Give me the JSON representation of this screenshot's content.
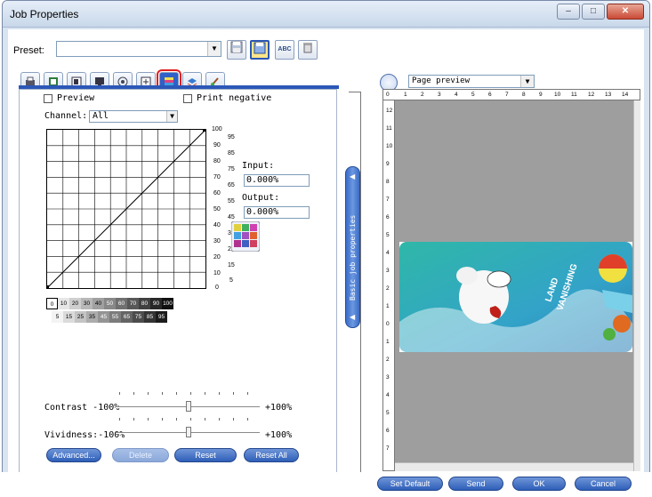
{
  "window": {
    "title": "Job Properties",
    "min_icon": "minimize-icon",
    "max_icon": "maximize-icon",
    "close_icon": "close-icon",
    "min_glyph": "–",
    "max_glyph": "□",
    "close_glyph": "✕"
  },
  "preset": {
    "label": "Preset:",
    "value": ""
  },
  "tabs": [
    "printer-tab",
    "media-tab",
    "layout-tab",
    "output-tab",
    "color-tab",
    "marks-tab",
    "curves-tab",
    "layers-tab",
    "paint-tab"
  ],
  "curves": {
    "preview_label": "Preview",
    "print_negative_label": "Print negative",
    "channel_label": "Channel:",
    "channel_value": "All",
    "input_label": "Input:",
    "input_value": "0.000%",
    "output_label": "Output:",
    "output_value": "0.000%",
    "scale_left": [
      "100",
      "90",
      "80",
      "70",
      "60",
      "50",
      "40",
      "30",
      "20",
      "10",
      "0"
    ],
    "scale_right": [
      "95",
      "85",
      "75",
      "65",
      "55",
      "45",
      "35",
      "25",
      "15",
      "5"
    ],
    "gradient_top": [
      "0",
      "10",
      "20",
      "30",
      "40",
      "50",
      "60",
      "70",
      "80",
      "90",
      "100"
    ],
    "gradient_bottom": [
      "5",
      "15",
      "25",
      "35",
      "45",
      "55",
      "65",
      "75",
      "85",
      "95"
    ],
    "contrast_label": "Contrast -100%",
    "contrast_max": "+100%",
    "contrast_value_percent": 0,
    "vividness_label": "Vividness:-100%",
    "vividness_max": "+100%",
    "vividness_value_percent": 0
  },
  "buttons": {
    "advanced": "Advanced...",
    "delete": "Delete",
    "reset": "Reset",
    "reset_all": "Reset All",
    "set_default": "Set Default",
    "send": "Send",
    "ok": "OK",
    "cancel": "Cancel"
  },
  "side_bar": {
    "label": "Basic job properties"
  },
  "preview": {
    "mode": "Page preview",
    "ruler_top": [
      "0",
      "1",
      "2",
      "3",
      "4",
      "5",
      "6",
      "7",
      "8",
      "9",
      "10",
      "11",
      "12",
      "13",
      "14"
    ],
    "ruler_left": [
      "12",
      "11",
      "10",
      "9",
      "8",
      "7",
      "6",
      "5",
      "4",
      "3",
      "2",
      "1",
      "0",
      "1",
      "2",
      "3",
      "4",
      "5",
      "6",
      "7"
    ],
    "artwork_text": [
      "LAND",
      "VANISHING"
    ]
  },
  "colors": {
    "accent": "#2b57b8",
    "highlight": "#e02020",
    "canvas": "#9e9e9e"
  }
}
